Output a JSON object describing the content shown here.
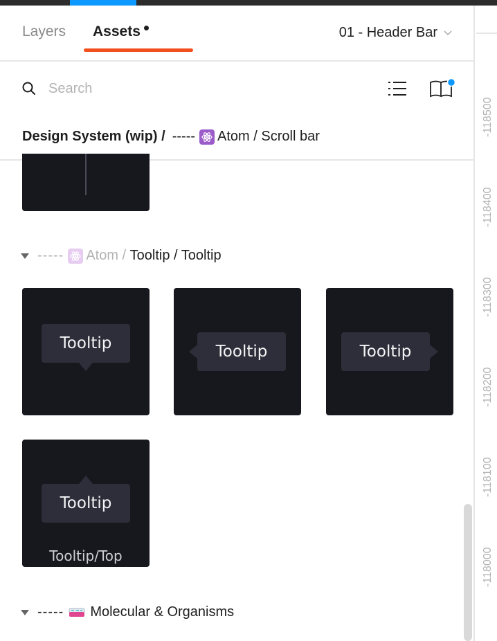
{
  "tabs": [
    {
      "label": "Layers",
      "active": false
    },
    {
      "label": "Assets",
      "active": true,
      "has_unread_dot": true
    }
  ],
  "page_selector": {
    "label": "01 - Header Bar",
    "icon": "chevron-down-icon"
  },
  "search": {
    "placeholder": "Search",
    "value": ""
  },
  "toolbar": {
    "view_toggle_icon": "list-view-icon",
    "library_icon": "library-book-icon",
    "library_badge_color": "#0d99ff"
  },
  "breadcrumb": {
    "root": "Design System (wip) /",
    "dashes": "-----",
    "emoji": "atom-symbol",
    "path": "Atom / Scroll bar"
  },
  "sections": [
    {
      "dashes": "-----",
      "emoji": "atom-symbol",
      "prefix": "Atom /",
      "title": "Tooltip / Tooltip",
      "expanded": true,
      "components": [
        {
          "preview_text": "Tooltip",
          "pointer": "bottom"
        },
        {
          "preview_text": "Tooltip",
          "pointer": "left"
        },
        {
          "preview_text": "Tooltip",
          "pointer": "right"
        },
        {
          "preview_text": "Tooltip",
          "pointer": "top",
          "hover_label": "Tooltip/Top"
        }
      ]
    },
    {
      "dashes": "-----",
      "emoji": "petri-dish",
      "title": "Molecular & Organisms",
      "expanded": true
    }
  ],
  "ruler": {
    "labels": [
      "-118500",
      "-118400",
      "-118300",
      "-118200",
      "-118100",
      "-118000"
    ]
  },
  "colors": {
    "accent_tab": "#f24e1e",
    "top_accent": "#0d99ff",
    "tile_bg": "#17171e",
    "tooltip_bg": "#2e2e3a"
  }
}
